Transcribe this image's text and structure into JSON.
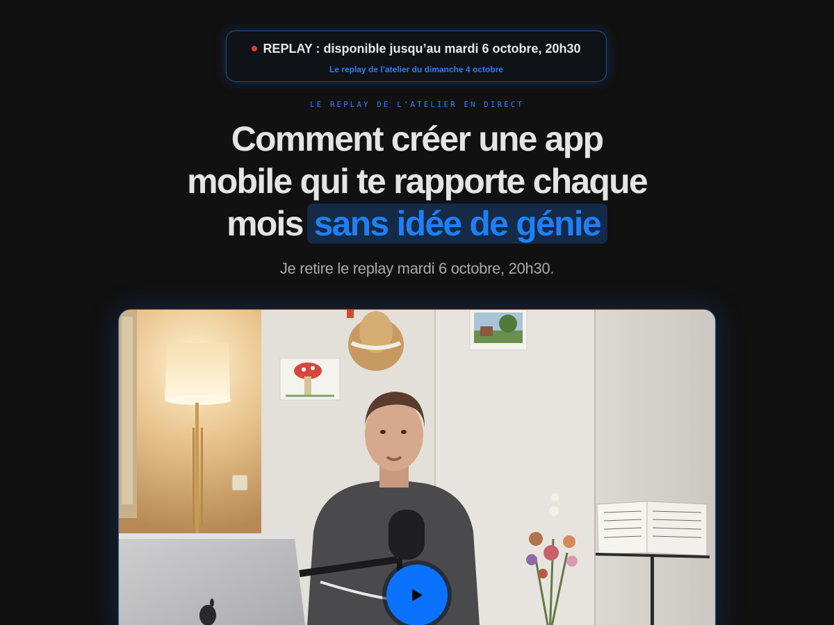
{
  "banner": {
    "title": "REPLAY : disponible jusqu’au mardi 6 octobre, 20h30",
    "subtitle": "Le replay de l’atelier du dimanche 4 octobre"
  },
  "eyebrow": "LE REPLAY DE L’ATELIER EN DIRECT",
  "headline": {
    "line1": "Comment créer une app",
    "line2": "mobile qui te rapporte chaque",
    "line3_prefix": "mois",
    "line3_highlight": "sans idée de génie"
  },
  "subtitle": "Je retire le replay mardi 6 octobre, 20h30.",
  "video": {
    "play_icon": "play-icon",
    "thumbnail_icons": [
      "floor-lamp",
      "straw-hat",
      "mushroom-drawing",
      "landscape-painting",
      "laptop",
      "microphone",
      "flower-bouquet",
      "music-stand"
    ]
  },
  "colors": {
    "background": "#111111",
    "accent": "#1f7ff5",
    "highlight_bg": "#142a47",
    "live_dot": "#e53935",
    "play_button": "#0a72ff"
  }
}
